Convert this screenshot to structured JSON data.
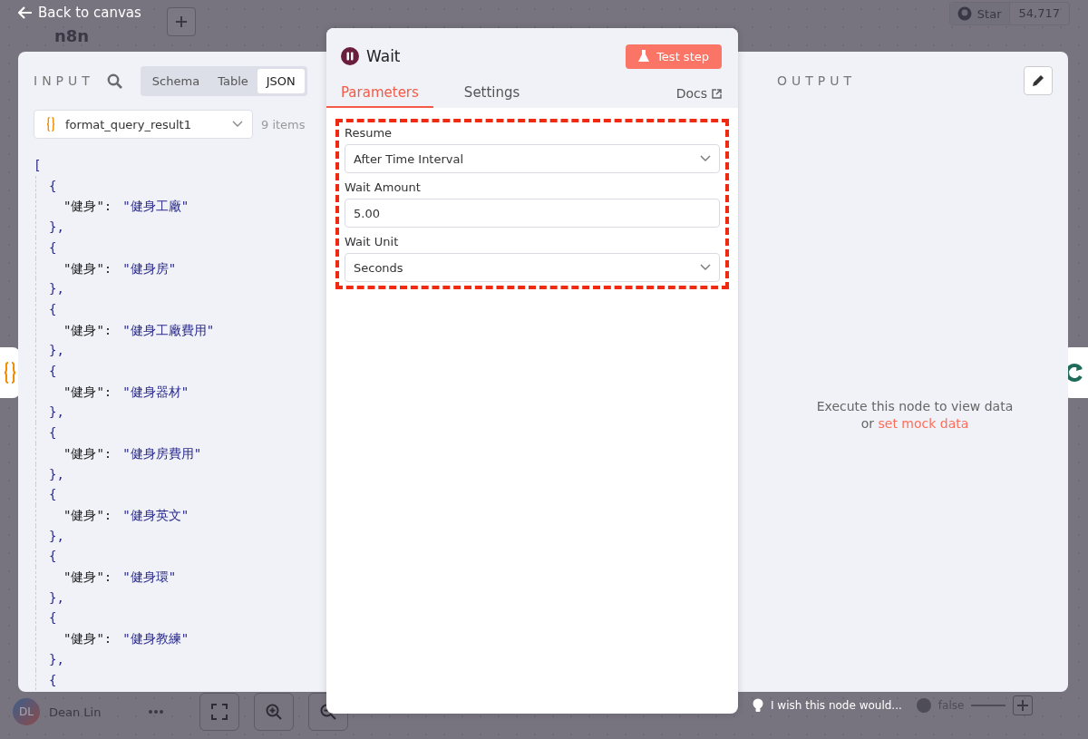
{
  "canvas": {
    "logo": "n8n",
    "back_link": "Back to canvas",
    "github_star": "Star",
    "star_count": "54,717",
    "user": {
      "initials": "DL",
      "name": "Dean Lin"
    },
    "hint": "I wish this node would...",
    "branch_label": "false"
  },
  "input": {
    "title": "INPUT",
    "views": [
      {
        "label": "Schema",
        "selected": false
      },
      {
        "label": "Table",
        "selected": false
      },
      {
        "label": "JSON",
        "selected": true
      }
    ],
    "source": "format_query_result1",
    "count": "9 items",
    "json_lines": [
      {
        "kind": "array",
        "text": "["
      },
      {
        "kind": "brace",
        "text": "{"
      },
      {
        "kind": "pair",
        "key": "\"健身\":",
        "value": "\"健身工廠\""
      },
      {
        "kind": "brace",
        "text": "},"
      },
      {
        "kind": "brace",
        "text": "{"
      },
      {
        "kind": "pair",
        "key": "\"健身\":",
        "value": "\"健身房\""
      },
      {
        "kind": "brace",
        "text": "},"
      },
      {
        "kind": "brace",
        "text": "{"
      },
      {
        "kind": "pair",
        "key": "\"健身\":",
        "value": "\"健身工廠費用\""
      },
      {
        "kind": "brace",
        "text": "},"
      },
      {
        "kind": "brace",
        "text": "{"
      },
      {
        "kind": "pair",
        "key": "\"健身\":",
        "value": "\"健身器材\""
      },
      {
        "kind": "brace",
        "text": "},"
      },
      {
        "kind": "brace",
        "text": "{"
      },
      {
        "kind": "pair",
        "key": "\"健身\":",
        "value": "\"健身房費用\""
      },
      {
        "kind": "brace",
        "text": "},"
      },
      {
        "kind": "brace",
        "text": "{"
      },
      {
        "kind": "pair",
        "key": "\"健身\":",
        "value": "\"健身英文\""
      },
      {
        "kind": "brace",
        "text": "},"
      },
      {
        "kind": "brace",
        "text": "{"
      },
      {
        "kind": "pair",
        "key": "\"健身\":",
        "value": "\"健身環\""
      },
      {
        "kind": "brace",
        "text": "},"
      },
      {
        "kind": "brace",
        "text": "{"
      },
      {
        "kind": "pair",
        "key": "\"健身\":",
        "value": "\"健身教練\""
      },
      {
        "kind": "brace",
        "text": "},"
      },
      {
        "kind": "brace",
        "text": "{"
      }
    ]
  },
  "node": {
    "title": "Wait",
    "test_button": "Test step",
    "tabs": [
      {
        "label": "Parameters",
        "selected": true
      },
      {
        "label": "Settings",
        "selected": false
      }
    ],
    "docs_link": "Docs",
    "fields": [
      {
        "kind": "select",
        "label": "Resume",
        "value": "After Time Interval"
      },
      {
        "kind": "number",
        "label": "Wait Amount",
        "value": "5.00"
      },
      {
        "kind": "select",
        "label": "Wait Unit",
        "value": "Seconds"
      }
    ]
  },
  "output": {
    "title": "OUTPUT",
    "empty_message": "Execute this node to view data",
    "or_text": "or",
    "mock_link": "set mock data"
  }
}
